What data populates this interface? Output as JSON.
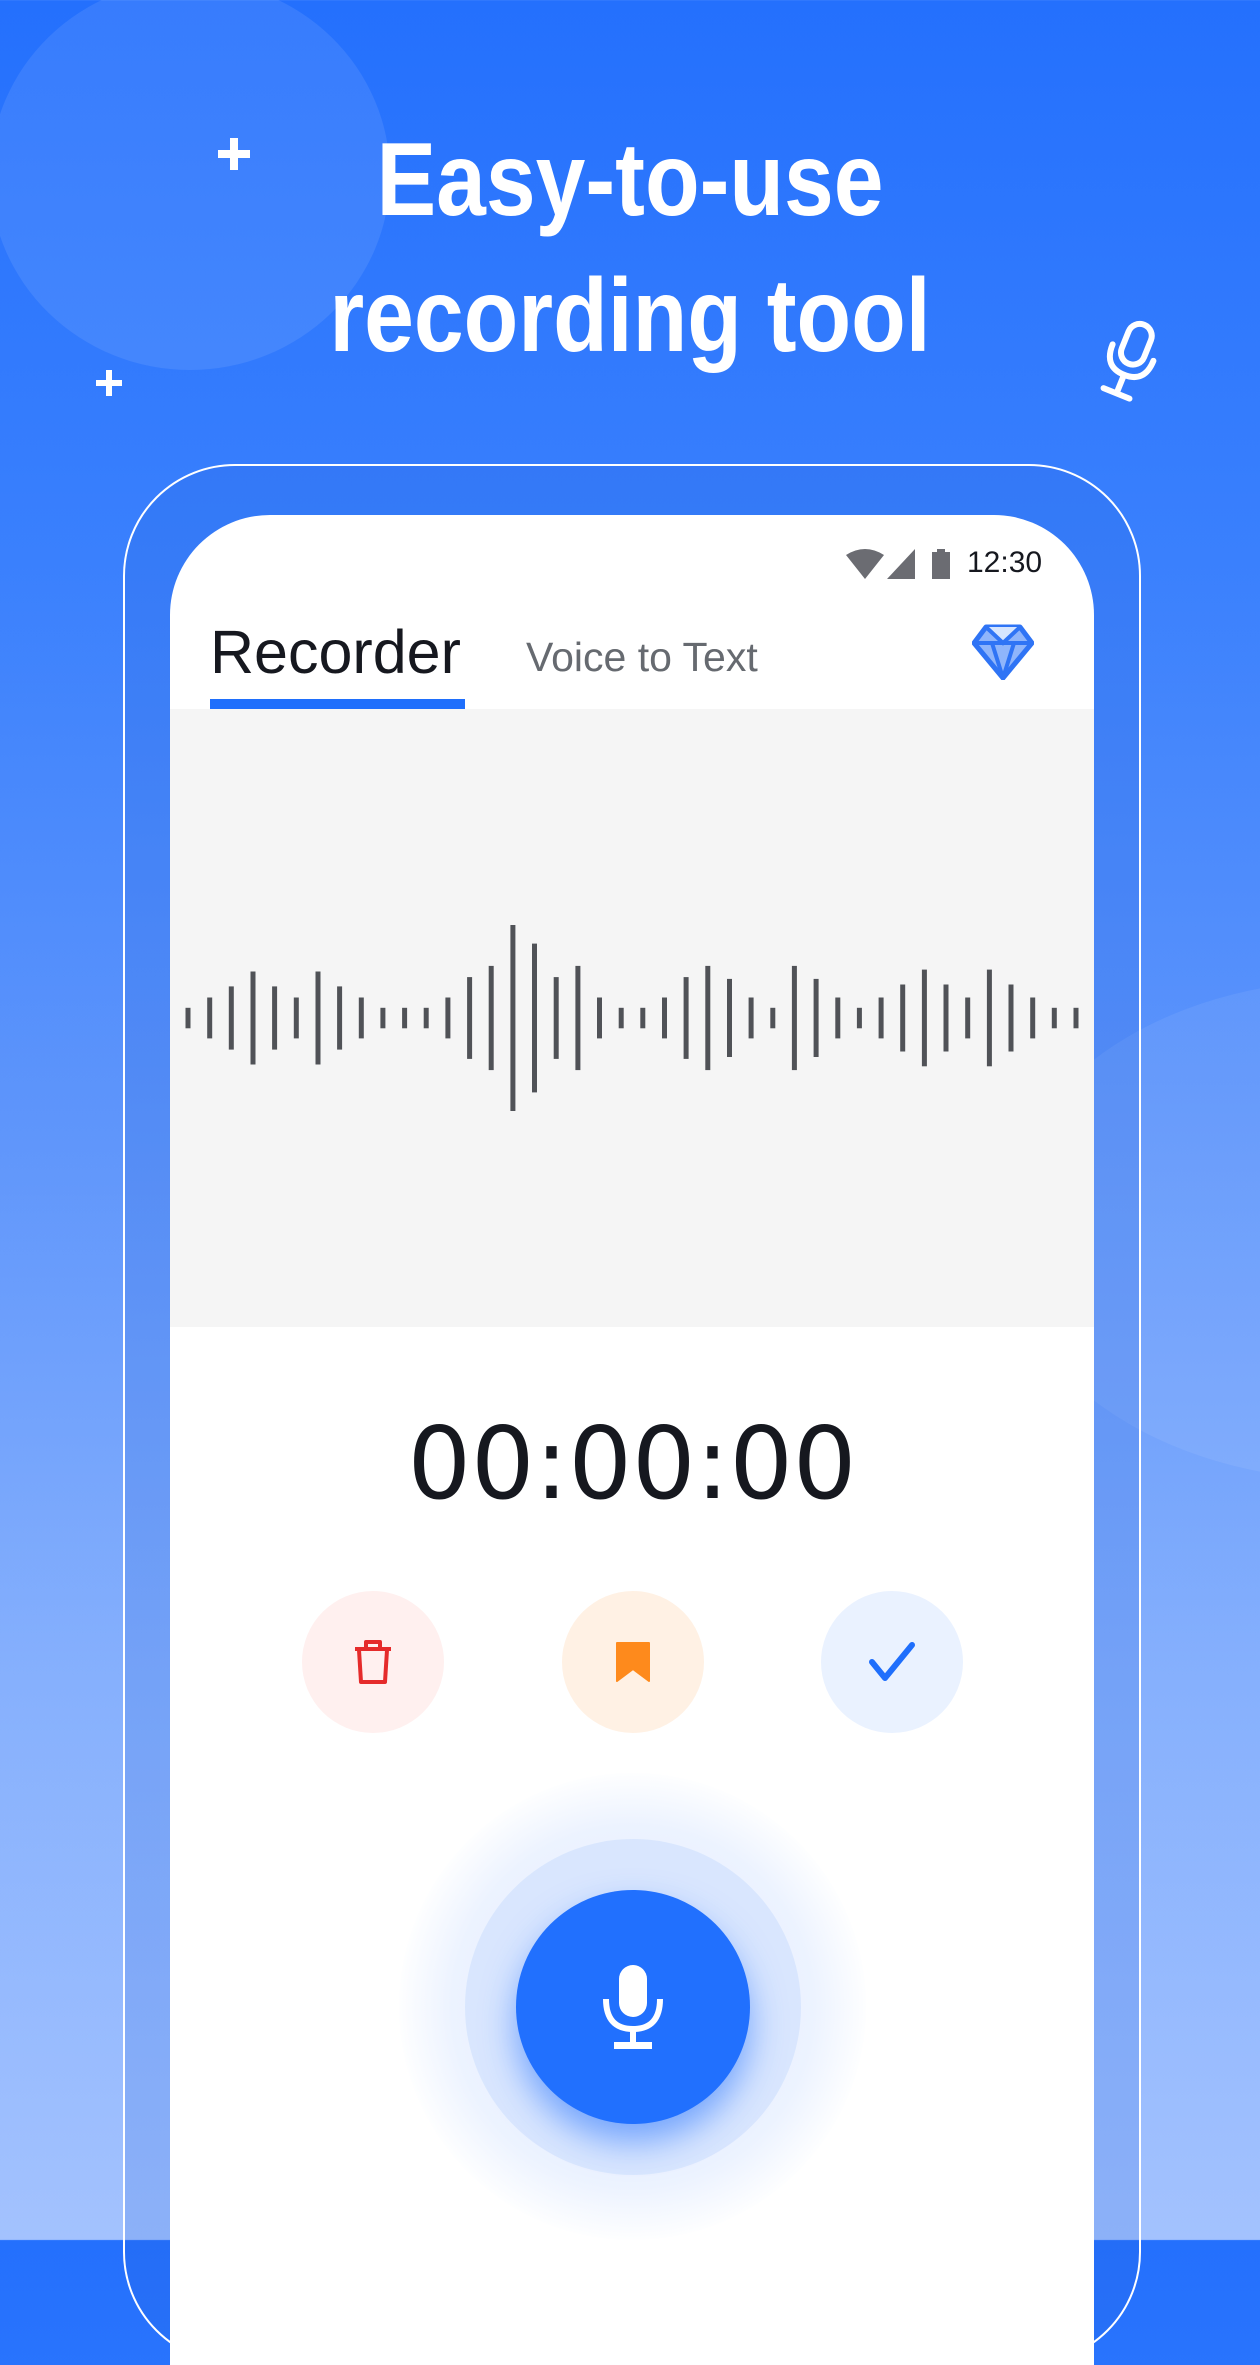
{
  "promo": {
    "headline_line1": "Easy-to-use",
    "headline_line2": "recording tool",
    "background_top_color": "#2470fd",
    "background_bottom_color": "#a3c2fe",
    "decorations": [
      "plus-icon",
      "plus-icon",
      "microphone-outline-icon"
    ]
  },
  "status_bar": {
    "time": "12:30",
    "icons": [
      "wifi-icon",
      "cellular-signal-icon",
      "battery-icon"
    ]
  },
  "tabs": [
    {
      "label": "Recorder",
      "active": true
    },
    {
      "label": "Voice to Text",
      "active": false
    }
  ],
  "header": {
    "premium_icon": "diamond-icon"
  },
  "waveform": {
    "bar_color": "#505257",
    "amplitudes": [
      0.11,
      0.22,
      0.34,
      0.5,
      0.34,
      0.22,
      0.5,
      0.34,
      0.22,
      0.11,
      0.11,
      0.11,
      0.22,
      0.44,
      0.56,
      1.0,
      0.8,
      0.44,
      0.56,
      0.22,
      0.11,
      0.11,
      0.22,
      0.44,
      0.56,
      0.42,
      0.22,
      0.11,
      0.56,
      0.42,
      0.22,
      0.11,
      0.22,
      0.36,
      0.52,
      0.36,
      0.22,
      0.52,
      0.36,
      0.22,
      0.11,
      0.11
    ]
  },
  "recorder": {
    "elapsed_time": "00:00:00",
    "actions": [
      {
        "name": "delete",
        "icon": "trash-icon",
        "color": "#e52b2b",
        "bg": "#fff0ef"
      },
      {
        "name": "mark",
        "icon": "bookmark-icon",
        "color": "#fe8a1c",
        "bg": "#fff1e4"
      },
      {
        "name": "done",
        "icon": "check-icon",
        "color": "#1f6ffc",
        "bg": "#eaf2ff"
      }
    ],
    "record_button_icon": "microphone-icon",
    "accent_color": "#2170fe"
  }
}
